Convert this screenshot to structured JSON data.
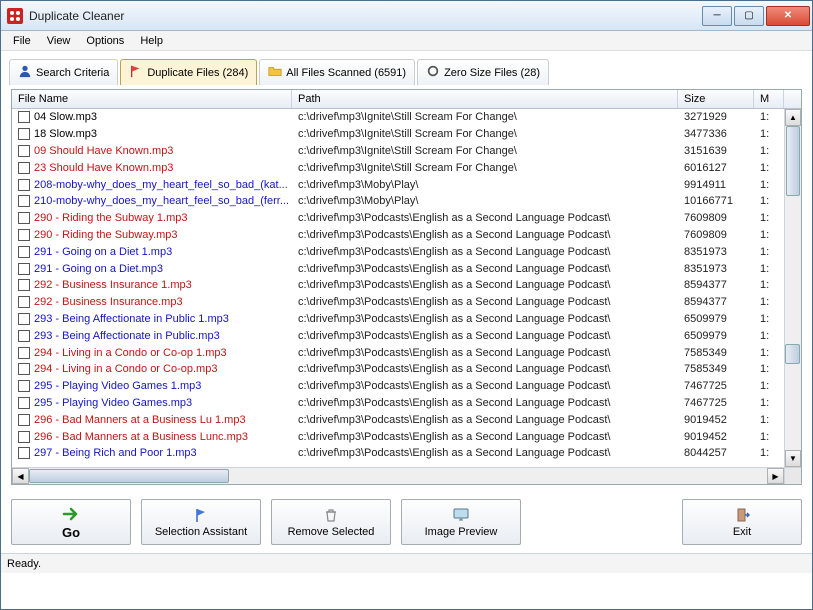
{
  "app": {
    "title": "Duplicate Cleaner"
  },
  "menu": {
    "file": "File",
    "view": "View",
    "options": "Options",
    "help": "Help"
  },
  "tabs": {
    "search": "Search Criteria",
    "dup": "Duplicate Files (284)",
    "all": "All Files Scanned (6591)",
    "zero": "Zero Size Files (28)"
  },
  "cols": {
    "file": "File Name",
    "path": "Path",
    "size": "Size",
    "m": "M"
  },
  "rows": [
    {
      "f": "04 Slow.mp3",
      "p": "c:\\drivef\\mp3\\Ignite\\Still Scream For Change\\",
      "s": "3271929",
      "m": "1:",
      "c": "black"
    },
    {
      "f": "18 Slow.mp3",
      "p": "c:\\drivef\\mp3\\Ignite\\Still Scream For Change\\",
      "s": "3477336",
      "m": "1:",
      "c": "black"
    },
    {
      "f": "09 Should Have Known.mp3",
      "p": "c:\\drivef\\mp3\\Ignite\\Still Scream For Change\\",
      "s": "3151639",
      "m": "1:",
      "c": "red"
    },
    {
      "f": "23 Should Have Known.mp3",
      "p": "c:\\drivef\\mp3\\Ignite\\Still Scream For Change\\",
      "s": "6016127",
      "m": "1:",
      "c": "red"
    },
    {
      "f": "208-moby-why_does_my_heart_feel_so_bad_(kat...",
      "p": "c:\\drivef\\mp3\\Moby\\Play\\",
      "s": "9914911",
      "m": "1:",
      "c": "blue"
    },
    {
      "f": "210-moby-why_does_my_heart_feel_so_bad_(ferr...",
      "p": "c:\\drivef\\mp3\\Moby\\Play\\",
      "s": "10166771",
      "m": "1:",
      "c": "blue"
    },
    {
      "f": "290 - Riding the Subway 1.mp3",
      "p": "c:\\drivef\\mp3\\Podcasts\\English as a Second Language Podcast\\",
      "s": "7609809",
      "m": "1:",
      "c": "red"
    },
    {
      "f": "290 - Riding the Subway.mp3",
      "p": "c:\\drivef\\mp3\\Podcasts\\English as a Second Language Podcast\\",
      "s": "7609809",
      "m": "1:",
      "c": "red"
    },
    {
      "f": "291 - Going on a Diet 1.mp3",
      "p": "c:\\drivef\\mp3\\Podcasts\\English as a Second Language Podcast\\",
      "s": "8351973",
      "m": "1:",
      "c": "blue"
    },
    {
      "f": "291 - Going on a Diet.mp3",
      "p": "c:\\drivef\\mp3\\Podcasts\\English as a Second Language Podcast\\",
      "s": "8351973",
      "m": "1:",
      "c": "blue"
    },
    {
      "f": "292 - Business Insurance 1.mp3",
      "p": "c:\\drivef\\mp3\\Podcasts\\English as a Second Language Podcast\\",
      "s": "8594377",
      "m": "1:",
      "c": "red"
    },
    {
      "f": "292 - Business Insurance.mp3",
      "p": "c:\\drivef\\mp3\\Podcasts\\English as a Second Language Podcast\\",
      "s": "8594377",
      "m": "1:",
      "c": "red"
    },
    {
      "f": "293 - Being Affectionate in Public 1.mp3",
      "p": "c:\\drivef\\mp3\\Podcasts\\English as a Second Language Podcast\\",
      "s": "6509979",
      "m": "1:",
      "c": "blue"
    },
    {
      "f": "293 - Being Affectionate in Public.mp3",
      "p": "c:\\drivef\\mp3\\Podcasts\\English as a Second Language Podcast\\",
      "s": "6509979",
      "m": "1:",
      "c": "blue"
    },
    {
      "f": "294 - Living in a Condo or Co-op 1.mp3",
      "p": "c:\\drivef\\mp3\\Podcasts\\English as a Second Language Podcast\\",
      "s": "7585349",
      "m": "1:",
      "c": "red"
    },
    {
      "f": "294 - Living in a Condo or Co-op.mp3",
      "p": "c:\\drivef\\mp3\\Podcasts\\English as a Second Language Podcast\\",
      "s": "7585349",
      "m": "1:",
      "c": "red"
    },
    {
      "f": "295 - Playing Video Games 1.mp3",
      "p": "c:\\drivef\\mp3\\Podcasts\\English as a Second Language Podcast\\",
      "s": "7467725",
      "m": "1:",
      "c": "blue"
    },
    {
      "f": "295 - Playing Video Games.mp3",
      "p": "c:\\drivef\\mp3\\Podcasts\\English as a Second Language Podcast\\",
      "s": "7467725",
      "m": "1:",
      "c": "blue"
    },
    {
      "f": "296 - Bad Manners at a Business Lu 1.mp3",
      "p": "c:\\drivef\\mp3\\Podcasts\\English as a Second Language Podcast\\",
      "s": "9019452",
      "m": "1:",
      "c": "red"
    },
    {
      "f": "296 - Bad Manners at a Business Lunc.mp3",
      "p": "c:\\drivef\\mp3\\Podcasts\\English as a Second Language Podcast\\",
      "s": "9019452",
      "m": "1:",
      "c": "red"
    },
    {
      "f": "297 - Being Rich and Poor 1.mp3",
      "p": "c:\\drivef\\mp3\\Podcasts\\English as a Second Language Podcast\\",
      "s": "8044257",
      "m": "1:",
      "c": "blue"
    }
  ],
  "buttons": {
    "go": "Go",
    "sel": "Selection Assistant",
    "rem": "Remove Selected",
    "img": "Image Preview",
    "exit": "Exit"
  },
  "status": "Ready."
}
